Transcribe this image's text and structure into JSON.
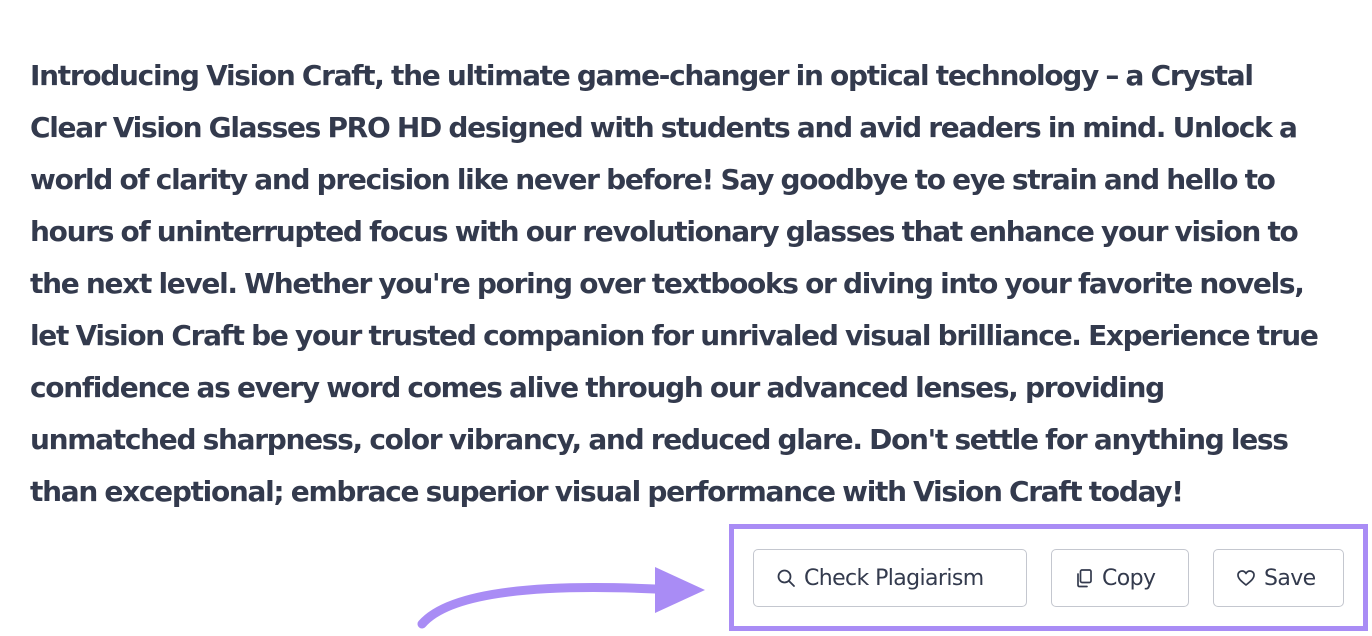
{
  "result": {
    "text": "Introducing Vision Craft, the ultimate game-changer in optical technology – a Crystal Clear Vision Glasses PRO HD designed with students and avid readers in mind. Unlock a world of clarity and precision like never before! Say goodbye to eye strain and hello to hours of uninterrupted focus with our revolutionary glasses that enhance your vision to the next level. Whether you're poring over textbooks or diving into your favorite novels, let Vision Craft be your trusted companion for unrivaled visual brilliance. Experience true confidence as every word comes alive through our advanced lenses, providing unmatched sharpness, color vibrancy, and reduced glare. Don't settle for anything less than exceptional; embrace superior visual performance with Vision Craft today!"
  },
  "actions": {
    "check_plagiarism": {
      "label": "Check Plagiarism",
      "icon": "search-icon"
    },
    "copy": {
      "label": "Copy",
      "icon": "copy-icon"
    },
    "save": {
      "label": "Save",
      "icon": "heart-icon"
    }
  },
  "annotation": {
    "highlight_color": "#a98cf5",
    "arrow_color": "#a98cf5"
  },
  "colors": {
    "text": "#333a4d",
    "button_border": "#c4c7cf",
    "background": "#ffffff"
  }
}
